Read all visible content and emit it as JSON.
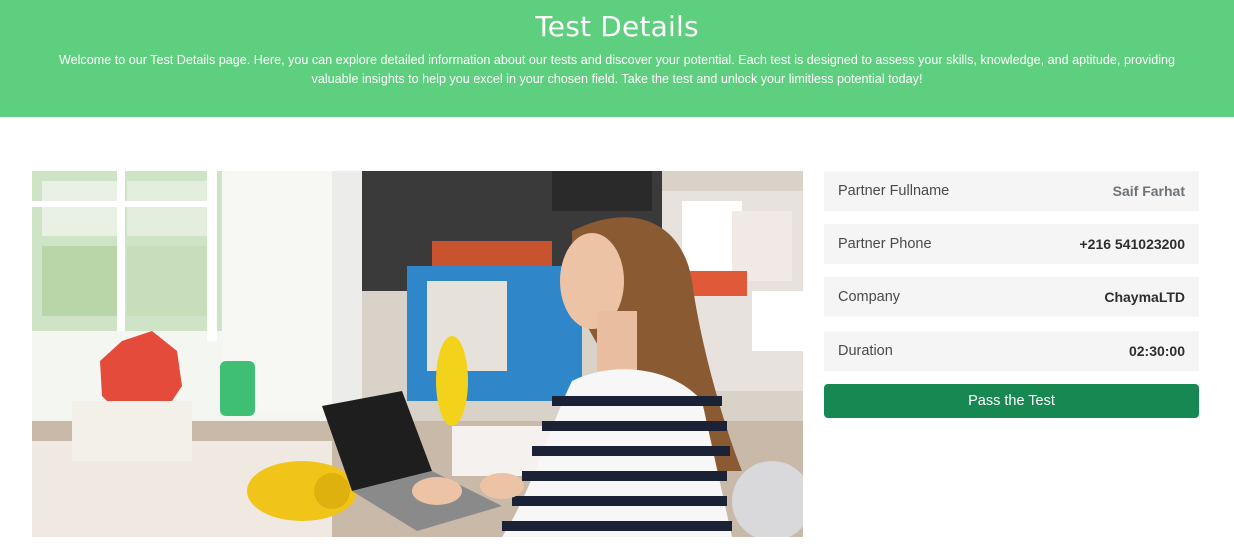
{
  "header": {
    "title": "Test Details",
    "description": "Welcome to our Test Details page. Here, you can explore detailed information about our tests and discover your potential. Each test is designed to assess your skills, knowledge, and aptitude, providing valuable insights to help you excel in your chosen field. Take the test and unlock your limitless potential today!"
  },
  "details": {
    "partner_fullname": {
      "label": "Partner Fullname",
      "value": "Saif Farhat"
    },
    "partner_phone": {
      "label": "Partner Phone",
      "value": "+216 541023200"
    },
    "company": {
      "label": "Company",
      "value": "ChaymaLTD"
    },
    "duration": {
      "label": "Duration",
      "value": "02:30:00"
    }
  },
  "actions": {
    "pass_test_label": "Pass the Test"
  },
  "colors": {
    "banner": "#5ecf7e",
    "button": "#178852",
    "row_background": "#f5f5f5"
  }
}
